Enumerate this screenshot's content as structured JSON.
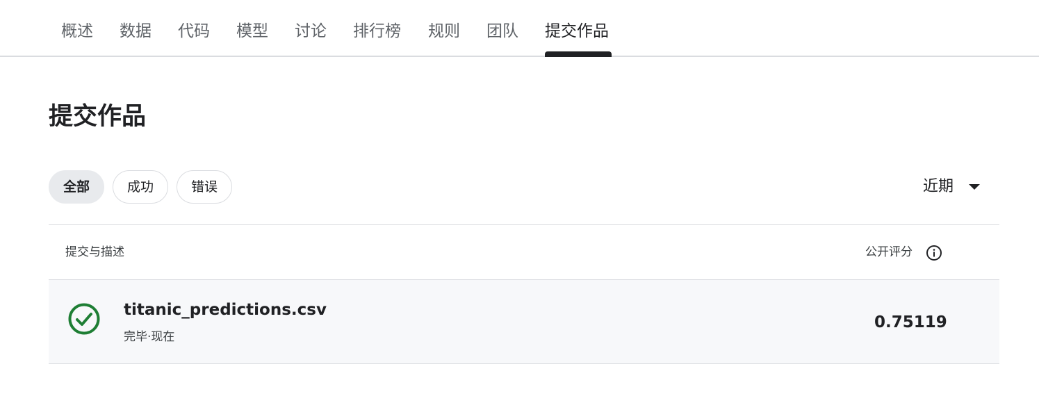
{
  "tabs": [
    {
      "label": "概述",
      "active": false
    },
    {
      "label": "数据",
      "active": false
    },
    {
      "label": "代码",
      "active": false
    },
    {
      "label": "模型",
      "active": false
    },
    {
      "label": "讨论",
      "active": false
    },
    {
      "label": "排行榜",
      "active": false
    },
    {
      "label": "规则",
      "active": false
    },
    {
      "label": "团队",
      "active": false
    },
    {
      "label": "提交作品",
      "active": true
    }
  ],
  "page_title": "提交作品",
  "filters": [
    {
      "label": "全部",
      "selected": true
    },
    {
      "label": "成功",
      "selected": false
    },
    {
      "label": "错误",
      "selected": false
    }
  ],
  "sort": {
    "label": "近期",
    "icon": "caret-down-icon"
  },
  "table": {
    "header_left": "提交与描述",
    "header_right": "公开评分",
    "header_info_icon": "info-icon",
    "rows": [
      {
        "status_icon": "check-circle-icon",
        "status_color": "#1e7e34",
        "file_name": "titanic_predictions.csv",
        "meta": "完毕·现在",
        "public_score": "0.75119"
      }
    ]
  },
  "colors": {
    "text_primary": "#202124",
    "text_secondary": "#5f6368",
    "divider": "#dadce0",
    "row_background": "#f7f8fa",
    "success": "#1e7e34"
  }
}
